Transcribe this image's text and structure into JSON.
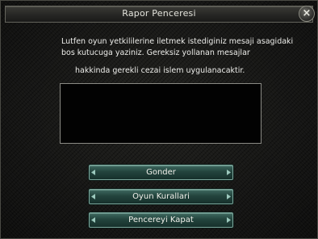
{
  "window": {
    "title": "Rapor Penceresi",
    "close_icon": "×"
  },
  "message": {
    "line1": "Lutfen oyun yetkililerine iletmek istediginiz mesaji asagidaki",
    "line2": "bos kutucuga yaziniz. Gereksiz yollanan mesajlar",
    "line3": "hakkinda gerekli cezai islem uygulanacaktir."
  },
  "report_input": {
    "value": ""
  },
  "buttons": {
    "send": "Gonder",
    "rules": "Oyun Kurallari",
    "close": "Pencereyi Kapat"
  },
  "colors": {
    "button_accent": "#3f6a61",
    "background": "#171716",
    "text": "#ededea"
  }
}
